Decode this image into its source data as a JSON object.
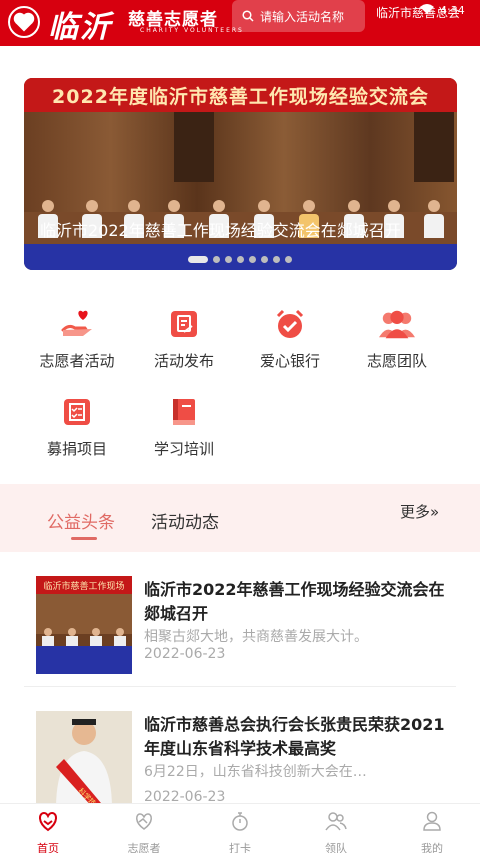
{
  "header": {
    "logo_city": "临沂",
    "logo_cn": "慈善志愿者",
    "logo_en": "CHARITY  VOLUNTEERS",
    "search_placeholder": "请输入活动名称",
    "right_text": "临沂市慈善总会",
    "status_time": "4:34",
    "brand_color": "#d7000f"
  },
  "banner": {
    "headline": "2022年度临沂市慈善工作现场经验交流会",
    "caption": "临沂市2022年慈善工作现场经验交流会在郯城召开",
    "slide_count": 9,
    "active_slide": 1
  },
  "grid": [
    {
      "label": "志愿者活动",
      "icon": "hand-heart-icon"
    },
    {
      "label": "活动发布",
      "icon": "document-edit-icon"
    },
    {
      "label": "爱心银行",
      "icon": "alarm-check-icon"
    },
    {
      "label": "志愿团队",
      "icon": "group-icon"
    },
    {
      "label": "募捐项目",
      "icon": "checklist-icon"
    },
    {
      "label": "学习培训",
      "icon": "book-icon"
    }
  ],
  "tabs": {
    "items": [
      "公益头条",
      "活动动态"
    ],
    "active": 0,
    "more_label": "更多",
    "accent": "#e06a64"
  },
  "news": [
    {
      "title": "临沂市2022年慈善工作现场经验交流会在郯城召开",
      "summary": "相聚古郯大地，共商慈善发展大计。",
      "date": "2022-06-23",
      "thumb_text": "临沂市慈善工作现场"
    },
    {
      "title": "临沂市慈善总会执行会长张贵民荣获2021年度山东省科学技术最高奖",
      "summary": "6月22日，山东省科技创新大会在…",
      "date": "2022-06-23",
      "thumb_text": "科学技术最高奖"
    }
  ],
  "bottom_nav": [
    {
      "label": "首页",
      "icon": "home-heart-icon",
      "active": true
    },
    {
      "label": "志愿者",
      "icon": "volunteer-heart-icon",
      "active": false
    },
    {
      "label": "打卡",
      "icon": "stopwatch-icon",
      "active": false
    },
    {
      "label": "领队",
      "icon": "team-icon",
      "active": false
    },
    {
      "label": "我的",
      "icon": "user-icon",
      "active": false
    }
  ]
}
